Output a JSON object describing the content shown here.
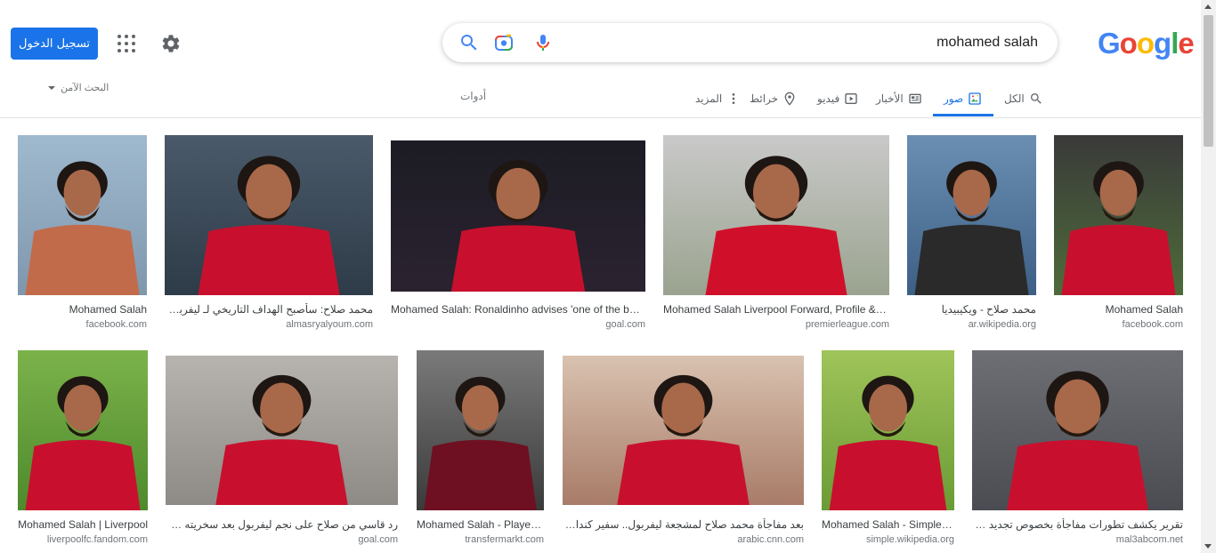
{
  "header": {
    "signin_label": "تسجيل الدخول",
    "search_query": "mohamed salah",
    "logo": [
      "G",
      "o",
      "o",
      "g",
      "l",
      "e"
    ],
    "logo_colors": [
      "#4285f4",
      "#ea4335",
      "#fbbc05",
      "#4285f4",
      "#34a853",
      "#ea4335"
    ],
    "safesearch_label": "البحث الآمن"
  },
  "tabs": {
    "all": "الكل",
    "images": "صور",
    "news": "الأخبار",
    "videos": "فيديو",
    "maps": "خرائط",
    "more": "المزيد",
    "tools": "أدوات"
  },
  "colors": {
    "accent": "#1a73e8",
    "liverpool_red": "#c8102e"
  },
  "results": [
    {
      "caption": "Mohamed Salah",
      "source": "facebook.com",
      "bg": [
        "#9fb9cf",
        "#7f97ad"
      ],
      "fig": "#c26b4a"
    },
    {
      "caption": "محمد صلاح: سأصبح الهداف التاريخي لـ ليفربول (فيديو)",
      "source": "almasryalyoum.com",
      "bg": [
        "#4a5a6a",
        "#2e3b48"
      ],
      "fig": "#c8102e"
    },
    {
      "caption": "Mohamed Salah: Ronaldinho advises 'one of the best'",
      "source": "goal.com",
      "bg": [
        "#1c1c24",
        "#2b2230"
      ],
      "fig": "#c8102e"
    },
    {
      "caption": "Mohamed Salah Liverpool Forward, Profile & Stats",
      "source": "premierleague.com",
      "bg": [
        "#c9c9c9",
        "#9aa38f"
      ],
      "fig": "#d0102a"
    },
    {
      "caption": "محمد صلاح - ويكيبيديا",
      "source": "ar.wikipedia.org",
      "bg": [
        "#6b8fb3",
        "#3d5f85"
      ],
      "fig": "#2a2a2a"
    },
    {
      "caption": "Mohamed Salah",
      "source": "facebook.com",
      "bg": [
        "#3a3a3a",
        "#4e6b3a"
      ],
      "fig": "#c8102e"
    },
    {
      "caption": "Mohamed Salah | Liverpool",
      "source": "liverpoolfc.fandom.com",
      "bg": [
        "#7bb24a",
        "#4e8a2c"
      ],
      "fig": "#c8102e"
    },
    {
      "caption": "رد قاسي من صلاح على نجم ليفربول بعد سخريته من قلة ركلاته",
      "source": "goal.com",
      "bg": [
        "#b7b3ae",
        "#8e8a86"
      ],
      "fig": "#c8102e"
    },
    {
      "caption": "Mohamed Salah - Player profile",
      "source": "transfermarkt.com",
      "bg": [
        "#7a7a7a",
        "#3a3a3a"
      ],
      "fig": "#6e1022"
    },
    {
      "caption": "بعد مفاجأة محمد صلاح لمشجعة ليفربول.. سفير كندا بمصر يعلق",
      "source": "arabic.cnn.com",
      "bg": [
        "#d9c2b0",
        "#a87c68"
      ],
      "fig": "#c8102e"
    },
    {
      "caption": "Mohamed Salah - Simple English Wikipedia",
      "source": "simple.wikipedia.org",
      "bg": [
        "#9fc45a",
        "#6b9b35"
      ],
      "fig": "#c8102e"
    },
    {
      "caption": "تقرير يكشف تطورات مفاجأة بخصوص تجديد عقد محمد صلاح",
      "source": "mal3abcom.net",
      "bg": [
        "#6d6f75",
        "#4a4c52"
      ],
      "fig": "#c8102e"
    }
  ]
}
